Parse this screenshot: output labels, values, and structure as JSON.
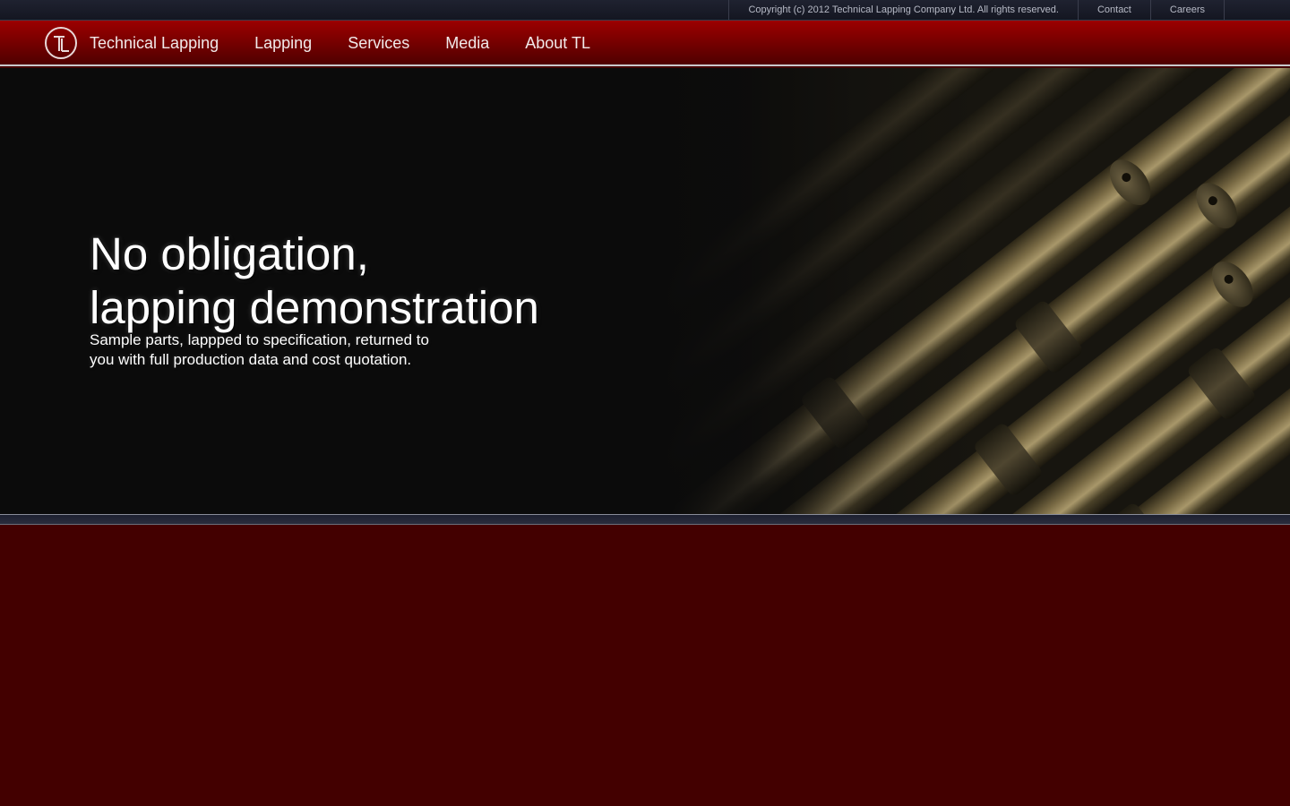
{
  "utility_bar": {
    "copyright": "Copyright (c) 2012 Technical Lapping Company Ltd. All rights reserved.",
    "links": [
      {
        "label": "Contact"
      },
      {
        "label": "Careers"
      }
    ]
  },
  "brand": {
    "logo_letters": "TL",
    "name": "Technical Lapping"
  },
  "nav": {
    "items": [
      {
        "label": "Lapping"
      },
      {
        "label": "Services"
      },
      {
        "label": "Media"
      },
      {
        "label": "About TL"
      }
    ]
  },
  "hero": {
    "headline_line1": "No obligation,",
    "headline_line2": "lapping demonstration",
    "subtext_line1": "Sample parts, lappped to specification, returned to",
    "subtext_line2": "you with full production data and cost quotation."
  },
  "colors": {
    "nav_red": "#9c0000",
    "footer_maroon": "#430000",
    "hero_black": "#0b0b0b",
    "utility_navy": "#1f2230"
  }
}
